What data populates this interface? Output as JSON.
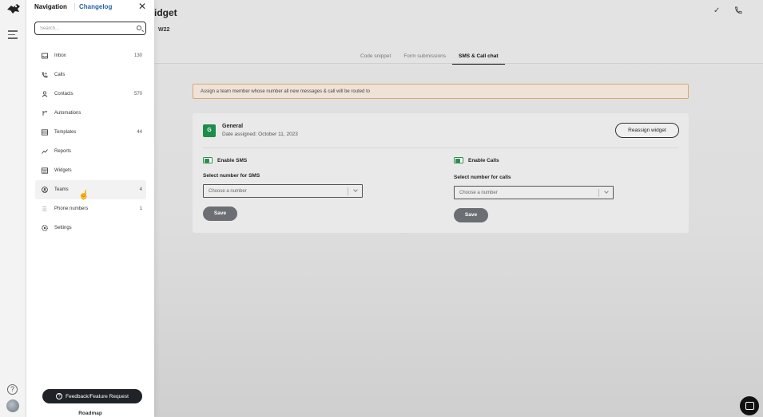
{
  "navigation": {
    "title": "Navigation",
    "changelog": "Changelog",
    "search_placeholder": "Search...",
    "items": [
      {
        "label": "Inbox",
        "count": "130",
        "icon": "inbox-icon"
      },
      {
        "label": "Calls",
        "count": "",
        "icon": "phone-call-icon"
      },
      {
        "label": "Contacts",
        "count": "570",
        "icon": "person-icon"
      },
      {
        "label": "Automations",
        "count": "",
        "icon": "branch-icon"
      },
      {
        "label": "Templates",
        "count": "44",
        "icon": "template-icon"
      },
      {
        "label": "Reports",
        "count": "",
        "icon": "trend-icon"
      },
      {
        "label": "Widgets",
        "count": "",
        "icon": "widget-icon"
      },
      {
        "label": "Teams",
        "count": "4",
        "icon": "teams-icon"
      },
      {
        "label": "Phone numbers",
        "count": "1",
        "icon": "phone-numbers-icon"
      },
      {
        "label": "Settings",
        "count": "",
        "icon": "gear-icon"
      }
    ],
    "feedback_button": "Feedback/Feature Request",
    "roadmap": "Roadmap"
  },
  "header": {
    "title": "idget",
    "subtitle": "W22"
  },
  "tabs": [
    {
      "label": "Code snippet",
      "active": false
    },
    {
      "label": "Form submissions",
      "active": false
    },
    {
      "label": "SMS & Call chat",
      "active": true
    }
  ],
  "notice": "Assign a team member whose number all new messages & call will be routed to",
  "team_card": {
    "avatar_letter": "G",
    "name": "General",
    "date_assigned": "Date assigned: October 11, 2023",
    "reassign_button": "Reassign widget",
    "sms": {
      "toggle_label": "Enable SMS",
      "select_label": "Select number for SMS",
      "placeholder": "Choose a number",
      "save": "Save"
    },
    "calls": {
      "toggle_label": "Enable Calls",
      "select_label": "Select number for calls",
      "placeholder": "Choose a number",
      "save": "Save"
    }
  },
  "colors": {
    "accent_green": "#2c8d4f",
    "link_blue": "#2563a9",
    "notice_border": "#d9a774"
  }
}
